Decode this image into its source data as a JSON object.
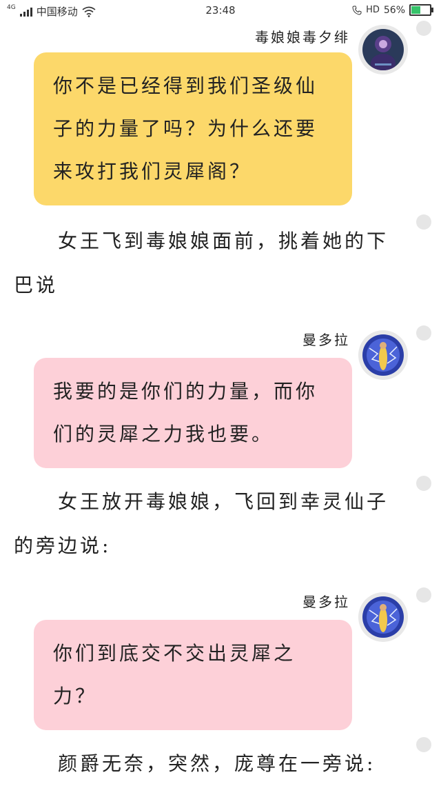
{
  "status_bar": {
    "network": "4G",
    "carrier": "中国移动",
    "time": "23:48",
    "hd": "HD",
    "battery_percent": "56%",
    "battery_level": 0.56,
    "battery_color": "#36c36a"
  },
  "messages": [
    {
      "speaker": "毒娘娘毒夕绯",
      "text": "你不是已经得到我们圣级仙子的力量了吗？为什么还要来攻打我们灵犀阁？",
      "bubble_color": "#fcd86a"
    },
    {
      "speaker": "曼多拉",
      "text": "我要的是你们的力量，而你们的灵犀之力我也要。",
      "bubble_color": "#fdd0d8"
    },
    {
      "speaker": "曼多拉",
      "text": "你们到底交不交出灵犀之力？",
      "bubble_color": "#fdd0d8"
    }
  ],
  "narrations": [
    "女王飞到毒娘娘面前，挑着她的下巴说",
    "女王放开毒娘娘，飞回到幸灵仙子的旁边说:",
    "颜爵无奈，突然，庞尊在一旁说:"
  ]
}
